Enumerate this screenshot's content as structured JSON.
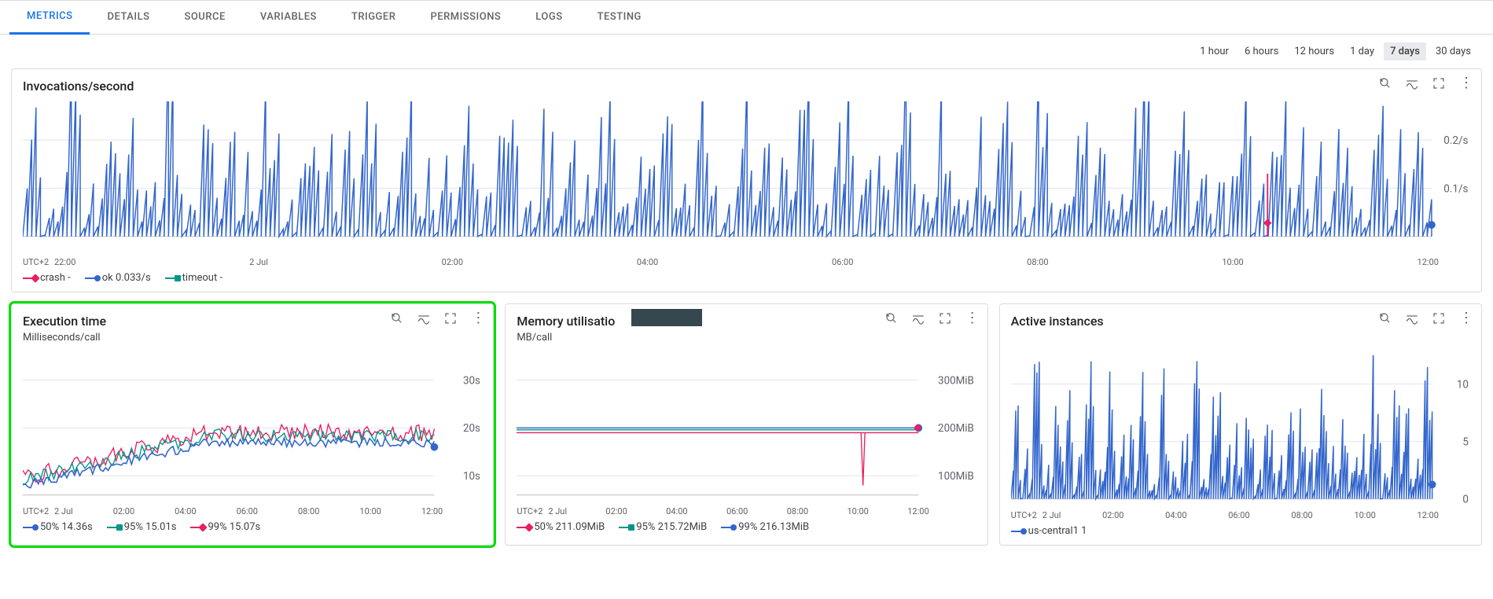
{
  "tabs": [
    {
      "label": "METRICS",
      "active": true
    },
    {
      "label": "DETAILS"
    },
    {
      "label": "SOURCE"
    },
    {
      "label": "VARIABLES"
    },
    {
      "label": "TRIGGER"
    },
    {
      "label": "PERMISSIONS"
    },
    {
      "label": "LOGS"
    },
    {
      "label": "TESTING"
    }
  ],
  "time_ranges": [
    {
      "label": "1 hour"
    },
    {
      "label": "6 hours"
    },
    {
      "label": "12 hours"
    },
    {
      "label": "1 day"
    },
    {
      "label": "7 days",
      "active": true
    },
    {
      "label": "30 days"
    }
  ],
  "timezone_label": "UTC+2",
  "x_ticks_full": [
    "22:00",
    "2 Jul",
    "02:00",
    "04:00",
    "06:00",
    "08:00",
    "10:00",
    "12:00"
  ],
  "x_ticks_small": [
    "2 Jul",
    "02:00",
    "04:00",
    "06:00",
    "08:00",
    "10:00",
    "12:00"
  ],
  "colors": {
    "blue": "#3366cc",
    "pink": "#e91e63",
    "teal": "#009688"
  },
  "cards": {
    "invocations": {
      "title": "Invocations/second",
      "y_ticks": [
        "0.2/s",
        "0.1/s"
      ],
      "legend": [
        {
          "name": "crash",
          "value": "-",
          "color": "#e91e63",
          "marker": "diamond"
        },
        {
          "name": "ok",
          "value": "0.033/s",
          "color": "#3366cc",
          "marker": "circle"
        },
        {
          "name": "timeout",
          "value": "-",
          "color": "#009688",
          "marker": "square"
        }
      ]
    },
    "exec": {
      "title": "Execution time",
      "subtitle": "Milliseconds/call",
      "y_ticks": [
        "30s",
        "20s",
        "10s"
      ],
      "legend": [
        {
          "name": "50%",
          "value": "14.36s",
          "color": "#3366cc",
          "marker": "circle"
        },
        {
          "name": "95%",
          "value": "15.01s",
          "color": "#009688",
          "marker": "square"
        },
        {
          "name": "99%",
          "value": "15.07s",
          "color": "#e91e63",
          "marker": "diamond"
        }
      ]
    },
    "mem": {
      "title": "Memory utilisatio",
      "subtitle": "MB/call",
      "y_ticks": [
        "300MiB",
        "200MiB",
        "100MiB"
      ],
      "legend": [
        {
          "name": "50%",
          "value": "211.09MiB",
          "color": "#e91e63",
          "marker": "diamond"
        },
        {
          "name": "95%",
          "value": "215.72MiB",
          "color": "#009688",
          "marker": "square"
        },
        {
          "name": "99%",
          "value": "216.13MiB",
          "color": "#3366cc",
          "marker": "circle"
        }
      ]
    },
    "inst": {
      "title": "Active instances",
      "y_ticks": [
        "10",
        "5",
        "0"
      ],
      "legend": [
        {
          "name": "us-central1",
          "value": "1",
          "color": "#3366cc",
          "marker": "circle"
        }
      ]
    }
  },
  "chart_data": [
    {
      "id": "invocations",
      "type": "line",
      "title": "Invocations/second",
      "xlabel": "UTC+2",
      "ylabel": "",
      "ylim": [
        0,
        0.3
      ],
      "x_range_hours": [
        "2 Jul 21:00",
        "3 Jul 13:00"
      ],
      "series": [
        {
          "name": "ok",
          "approx_mean": 0.033,
          "approx_range": [
            0,
            0.25
          ],
          "pattern": "dense noisy spikes across whole window"
        },
        {
          "name": "crash",
          "points": [
            {
              "t": "3 Jul ~11:00",
              "v": 0.12
            }
          ]
        },
        {
          "name": "timeout",
          "points": []
        }
      ]
    },
    {
      "id": "execution_time",
      "type": "line",
      "title": "Execution time",
      "subtitle": "Milliseconds/call",
      "xlabel": "UTC+2",
      "ylabel": "seconds",
      "ylim": [
        0,
        30
      ],
      "x_range_hours": [
        "2 Jul 21:00",
        "3 Jul 13:00"
      ],
      "series": [
        {
          "name": "50%",
          "last": 14.36,
          "approx_trend": "rises from ~5s at start to plateau ~15s by 04:00"
        },
        {
          "name": "95%",
          "last": 15.01,
          "approx_trend": "tracks 50% closely, plateau ~15–17s"
        },
        {
          "name": "99%",
          "last": 15.07,
          "approx_trend": "tracks 95% closely with occasional spikes to ~20s"
        }
      ]
    },
    {
      "id": "memory_utilisation",
      "type": "line",
      "title": "Memory utilisation",
      "subtitle": "MB/call",
      "xlabel": "UTC+2",
      "ylabel": "MiB",
      "ylim": [
        0,
        300
      ],
      "x_range_hours": [
        "2 Jul 21:00",
        "3 Jul 13:00"
      ],
      "series": [
        {
          "name": "50%",
          "last": 211.09,
          "approx_trend": "flat ~200–215 entire window; brief dip to ~60 near 09:30"
        },
        {
          "name": "95%",
          "last": 215.72,
          "approx_trend": "flat ~215"
        },
        {
          "name": "99%",
          "last": 216.13,
          "approx_trend": "flat ~216"
        }
      ]
    },
    {
      "id": "active_instances",
      "type": "line",
      "title": "Active instances",
      "xlabel": "UTC+2",
      "ylabel": "instances",
      "ylim": [
        0,
        10
      ],
      "x_range_hours": [
        "2 Jul 21:00",
        "3 Jul 13:00"
      ],
      "series": [
        {
          "name": "us-central1",
          "last": 1,
          "approx_range": [
            0,
            7
          ],
          "approx_mean": 2,
          "pattern": "frequent spikes 0–6, baseline ~1"
        }
      ]
    }
  ]
}
